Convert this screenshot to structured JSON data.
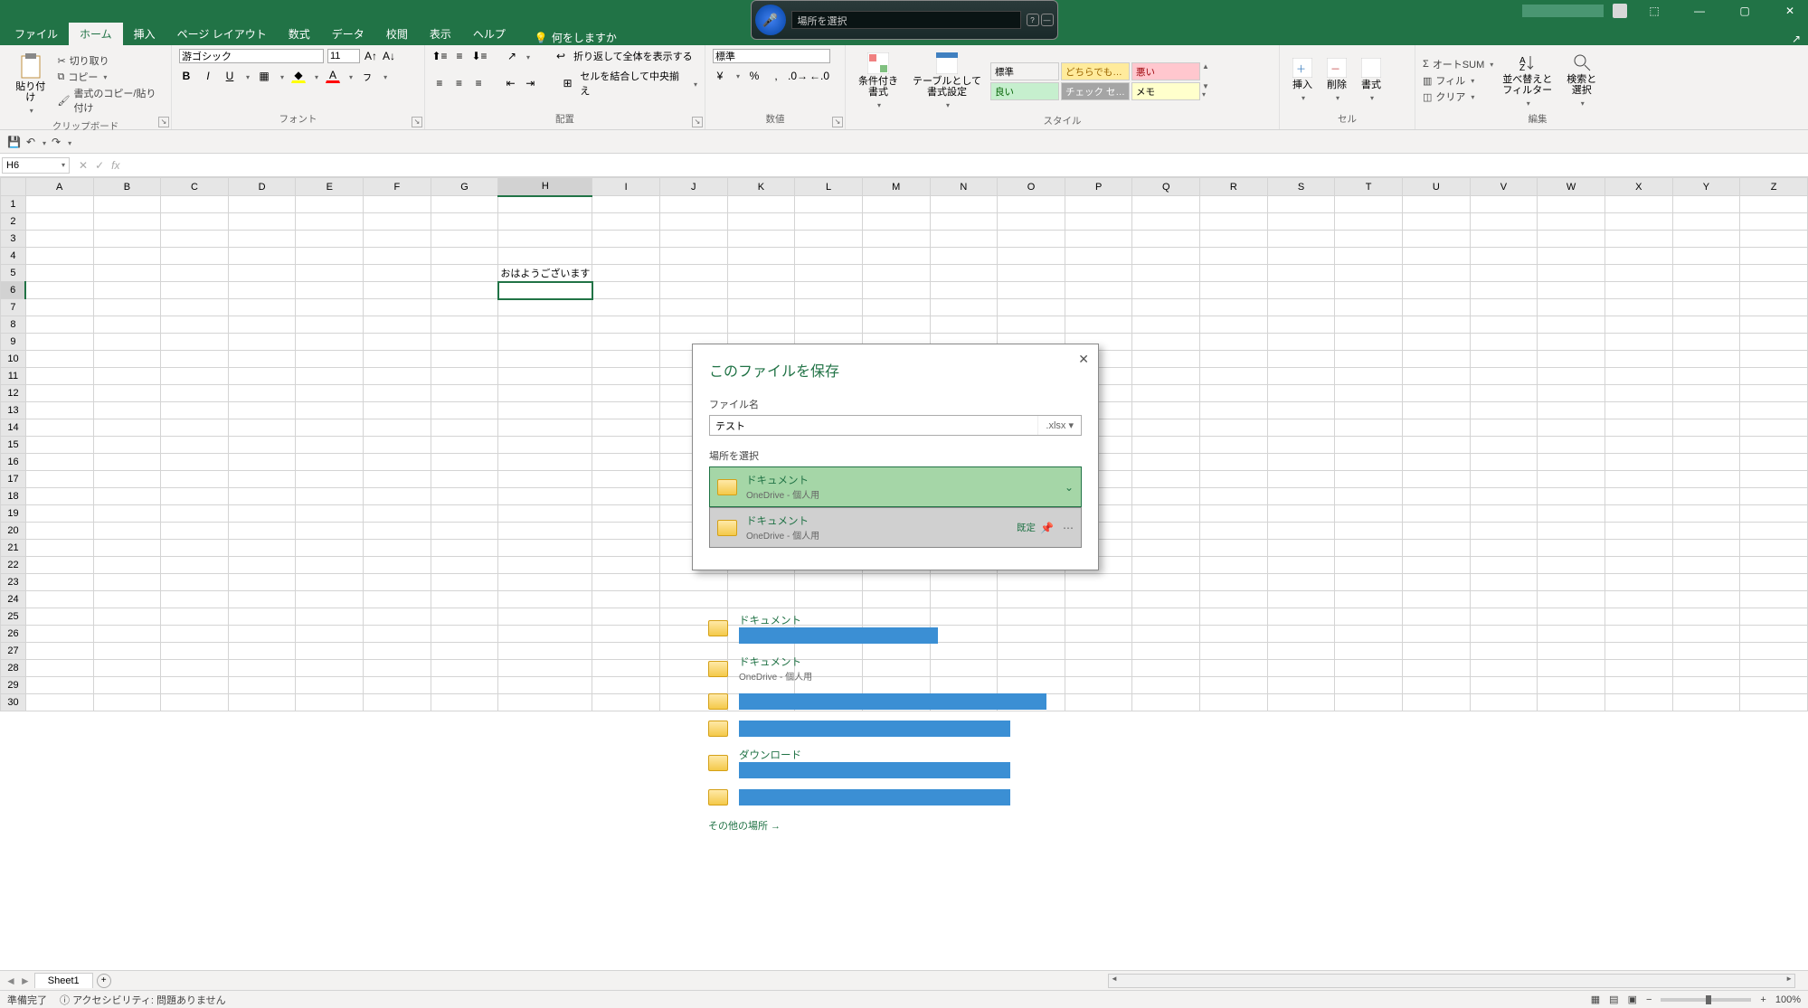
{
  "titlebar": {
    "speech_text": "場所を選択",
    "min": "—",
    "max": "▢",
    "close": "✕",
    "ribbon_toggle": "⬚"
  },
  "tabs": {
    "file": "ファイル",
    "home": "ホーム",
    "insert": "挿入",
    "page": "ページ レイアウト",
    "formula": "数式",
    "data": "データ",
    "review": "校閲",
    "view": "表示",
    "help": "ヘルプ",
    "tell": "何をしますか"
  },
  "ribbon": {
    "clipboard": {
      "label": "クリップボード",
      "paste": "貼り付け",
      "cut": "切り取り",
      "copy": "コピー",
      "format": "書式のコピー/貼り付け"
    },
    "font": {
      "label": "フォント",
      "name": "游ゴシック",
      "size": "11"
    },
    "align": {
      "label": "配置",
      "wrap": "折り返して全体を表示する",
      "merge": "セルを結合して中央揃え"
    },
    "number": {
      "label": "数値",
      "format": "標準"
    },
    "cond": {
      "label1": "条件付き\n書式",
      "label2": "テーブルとして\n書式設定"
    },
    "styles": {
      "label": "スタイル",
      "normal": "標準",
      "neutral": "どちらでも…",
      "bad": "悪い",
      "good": "良い",
      "check": "チェック セ…",
      "memo": "メモ"
    },
    "cells": {
      "label": "セル",
      "insert": "挿入",
      "delete": "削除",
      "format": "書式"
    },
    "editing": {
      "label": "編集",
      "autosum": "オートSUM",
      "fill": "フィル",
      "clear": "クリア",
      "sort": "並べ替えと\nフィルター",
      "find": "検索と\n選択"
    }
  },
  "name_box": "H6",
  "cell_content": "おはようございます",
  "columns": [
    "A",
    "B",
    "C",
    "D",
    "E",
    "F",
    "G",
    "H",
    "I",
    "J",
    "K",
    "L",
    "M",
    "N",
    "O",
    "P",
    "Q",
    "R",
    "S",
    "T",
    "U",
    "V",
    "W",
    "X",
    "Y",
    "Z"
  ],
  "rows": 30,
  "active": {
    "row": 6,
    "col": "H",
    "text_row": 5,
    "text_col": "H"
  },
  "sheet": {
    "name": "Sheet1"
  },
  "status": {
    "ready": "準備完了",
    "access_label": "アクセシビリティ:",
    "access": "問題ありません",
    "zoom": "100%"
  },
  "dialog": {
    "title": "このファイルを保存",
    "filename_label": "ファイル名",
    "filename": "テスト",
    "ext": ".xlsx",
    "location_label": "場所を選択",
    "selected": {
      "name": "ドキュメント",
      "sub": "OneDrive - 個人用"
    },
    "hover": {
      "name": "ドキュメント",
      "sub": "OneDrive - 個人用",
      "badge": "既定"
    },
    "extra": [
      {
        "name": "ドキュメント",
        "redact_w": 220
      },
      {
        "name": "ドキュメント",
        "sub": "OneDrive - 個人用"
      },
      {
        "redact_w": 340
      },
      {
        "redact_w": 300
      },
      {
        "name": "ダウンロード",
        "redact_w": 300
      },
      {
        "redact_w": 300
      }
    ],
    "other": "その他の場所"
  }
}
